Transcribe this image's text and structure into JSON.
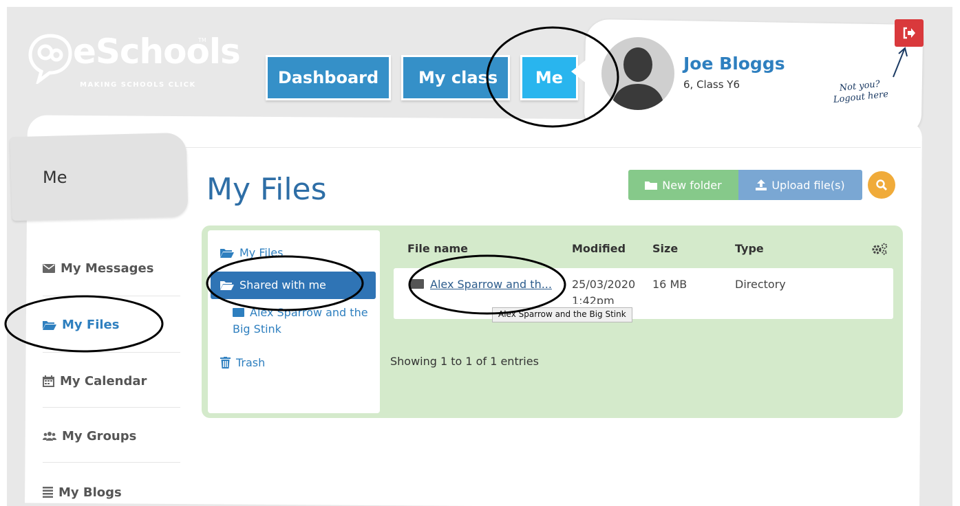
{
  "brand": {
    "name": "eSchools",
    "trademark": "TM",
    "tagline": "MAKING SCHOOLS CLICK"
  },
  "nav": {
    "dashboard": "Dashboard",
    "my_class": "My class",
    "me": "Me"
  },
  "profile": {
    "name": "Joe Bloggs",
    "class": "6, Class Y6",
    "logout_note_line1": "Not you?",
    "logout_note_line2": "Logout here"
  },
  "section_tab": "Me",
  "sidebar": {
    "items": [
      {
        "label": "My Messages",
        "icon": "envelope-icon"
      },
      {
        "label": "My Files",
        "icon": "folder-open-icon",
        "active": true
      },
      {
        "label": "My Calendar",
        "icon": "calendar-icon"
      },
      {
        "label": "My Groups",
        "icon": "users-icon"
      },
      {
        "label": "My Blogs",
        "icon": "list-icon"
      }
    ]
  },
  "page_title": "My Files",
  "toolbar": {
    "new_folder": "New folder",
    "upload": "Upload file(s)"
  },
  "tree": {
    "root": "My Files",
    "shared": "Shared with me",
    "subfolder": "Alex Sparrow and the Big Stink",
    "trash": "Trash"
  },
  "table": {
    "headers": {
      "name": "File name",
      "modified": "Modified",
      "size": "Size",
      "type": "Type"
    },
    "rows": [
      {
        "name": "Alex Sparrow and th...",
        "modified_date": "25/03/2020",
        "modified_time": "1:42pm",
        "size": "16 MB",
        "type": "Directory"
      }
    ],
    "tooltip": "Alex Sparrow and the Big Stink",
    "footer": "Showing 1 to 1 of 1 entries"
  },
  "colors": {
    "primary": "#3590c8",
    "accent": "#29b5ee",
    "link": "#2e7fbf",
    "panel_green": "#d4eacb",
    "logout_red": "#d9393c",
    "search_orange": "#f0ab3a"
  }
}
